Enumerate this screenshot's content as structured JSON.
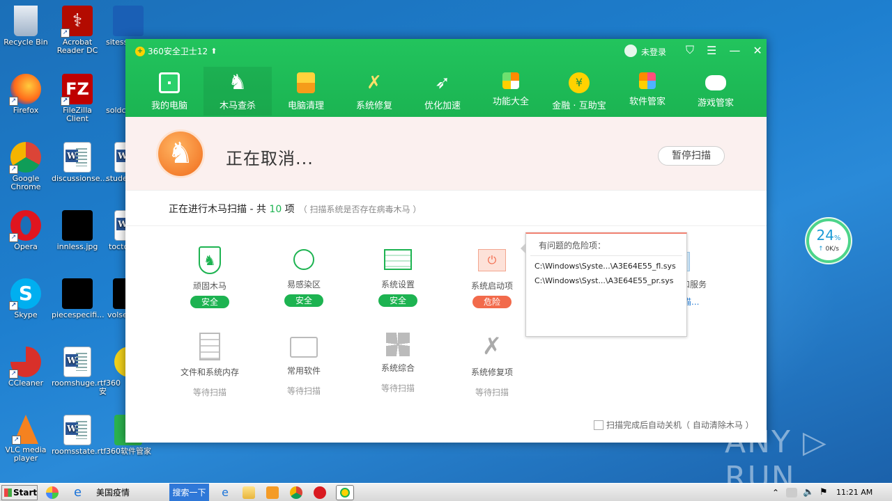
{
  "desktop": {
    "icons": [
      {
        "label": "Recycle Bin"
      },
      {
        "label": "Acrobat Reader DC"
      },
      {
        "label": "sitess"
      },
      {
        "label": "Firefox"
      },
      {
        "label": "FileZilla Client"
      },
      {
        "label": "soldca"
      },
      {
        "label": "Google Chrome"
      },
      {
        "label": "discussionse..."
      },
      {
        "label": "stude"
      },
      {
        "label": "Opera"
      },
      {
        "label": "innless.jpg"
      },
      {
        "label": "toctc"
      },
      {
        "label": "Skype"
      },
      {
        "label": "piecespecifi..."
      },
      {
        "label": "volse"
      },
      {
        "label": "CCleaner"
      },
      {
        "label": "roomshuge.rtf"
      },
      {
        "label": "360安"
      },
      {
        "label": "VLC media player"
      },
      {
        "label": "roomsstate.rtf"
      },
      {
        "label": "360软件管家"
      }
    ]
  },
  "app": {
    "title": "360安全卫士12",
    "user_label": "未登录",
    "tabs": [
      {
        "label": "我的电脑"
      },
      {
        "label": "木马查杀"
      },
      {
        "label": "电脑清理"
      },
      {
        "label": "系统修复"
      },
      {
        "label": "优化加速"
      },
      {
        "label": "功能大全"
      },
      {
        "label": "金融 · 互助宝"
      },
      {
        "label": "软件管家"
      },
      {
        "label": "游戏管家"
      }
    ],
    "status_text": "正在取消...",
    "pause_button": "暂停扫描",
    "scan": {
      "prefix": "正在进行木马扫描 - 共 ",
      "count": "10",
      "suffix": " 项",
      "hint": "（ 扫描系统是否存在病毒木马 ）"
    },
    "items_row1": [
      {
        "label": "顽固木马",
        "status": "安全"
      },
      {
        "label": "易感染区",
        "status": "安全"
      },
      {
        "label": "系统设置",
        "status": "安全"
      },
      {
        "label": "系统启动项",
        "status": "危险"
      },
      {
        "label": "和服务",
        "status": "描..."
      }
    ],
    "items_row2": [
      {
        "label": "文件和系统内存",
        "status": "等待扫描"
      },
      {
        "label": "常用软件",
        "status": "等待扫描"
      },
      {
        "label": "系统综合",
        "status": "等待扫描"
      },
      {
        "label": "系统修复项",
        "status": "等待扫描"
      }
    ],
    "popup": {
      "header": "有问题的危险项：",
      "items": [
        "C:\\Windows\\Syste...\\A3E64E55_fl.sys",
        "C:\\Windows\\Syst...\\A3E64E55_pr.sys"
      ]
    },
    "auto_shutdown": "扫描完成后自动关机（ 自动清除木马 ）"
  },
  "speed_widget": {
    "percent": "24",
    "unit": "%",
    "rate": "0K/s"
  },
  "watermark": "ANY ▷ RUN",
  "taskbar": {
    "start": "Start",
    "window_title": "美国疫情",
    "search": "搜索一下",
    "clock": "11:21 AM"
  },
  "colors": {
    "green": "#1db351",
    "danger": "#f26a4b",
    "titlebar": "#1fbd57"
  }
}
